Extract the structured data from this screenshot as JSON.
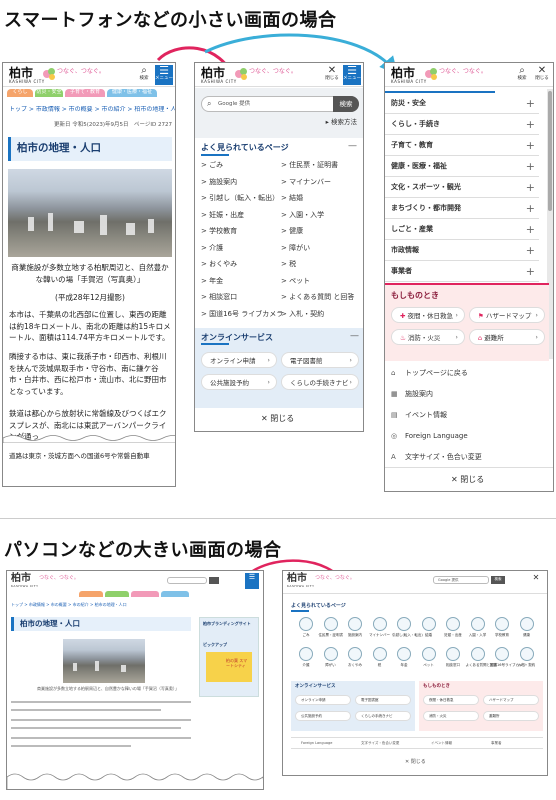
{
  "headings": {
    "smartphone": "スマートフォンなどの小さい画面の場合",
    "pc": "パソコンなどの大きい画面の場合"
  },
  "brand": {
    "logo_text": "柏市",
    "logo_sub": "KASHIWA CITY",
    "slogan": "つなぐ、つなぐ。"
  },
  "header_buttons": {
    "search": "検索",
    "menu": "メニュー",
    "close": "閉じる"
  },
  "page": {
    "breadcrumb": "トップ > 市政情報 > 市の概要 > 市の紹介 > 柏市の地理・人口",
    "updated": "更新日 令和5(2023)年9月5日　ページID 2727",
    "title": "柏市の地理・人口",
    "caption": "商業施設が多数立地する柏駅周辺と、自然豊かな韓いの場「手賀沼（写真奥）」",
    "photo_date": "(平成28年12月撮影)",
    "paragraphs": [
      "本市は、千葉県の北西部に位置し、東西の距離は約18キロメートル、南北の距離は約15キロメートル、面積は114.74平方キロメートルです。",
      "隣接する市は、東に我孫子市・印西市、利根川を挟んで茨城県取手市・守谷市、南に鎌ケ谷市・白井市、西に松戸市・流山市、北に野田市となっています。",
      "鉄道は都心から放射状に常磐線及びつくばエクスプレスが、南北には東武アーバンパークラインが通っ"
    ],
    "fragment": "道路は東京・茨城方面への国道6号や常磐自動車"
  },
  "nav_tabs": [
    "くらし",
    "防災・安全",
    "子育て・教育",
    "健康・医療・福祉"
  ],
  "menu_panel": {
    "search_placeholder": "Google 提供",
    "search_button": "検索",
    "search_help": "検索方法",
    "popular_title": "よく見られているページ",
    "popular_items": [
      "ごみ",
      "住民票・証明書",
      "施設案内",
      "マイナンバー",
      "引越し（転入・転出）",
      "結婚",
      "妊娠・出産",
      "入園・入学",
      "学校教育",
      "健康",
      "介護",
      "障がい",
      "おくやみ",
      "税",
      "年金",
      "ペット",
      "相談窓口",
      "よくある質問 と回答",
      "国道16号 ライブカメラ",
      "入札・契約"
    ],
    "online_title": "オンラインサービス",
    "online_items": [
      "オンライン申請",
      "電子図書館",
      "公共施設予約",
      "くらしの手続きナビ"
    ],
    "close": "閉じる"
  },
  "category_panel": {
    "categories": [
      "防災・安全",
      "くらし・手続き",
      "子育て・教育",
      "健康・医療・福祉",
      "文化・スポーツ・観光",
      "まちづくり・都市開発",
      "しごと・産業",
      "市政情報",
      "事業者"
    ],
    "emergency_title": "もしものとき",
    "emergency_items": [
      "夜間・休日救急",
      "ハザードマップ",
      "消防・火災",
      "避難所"
    ],
    "links": [
      "トップページに戻る",
      "施設案内",
      "イベント情報",
      "Foreign Language",
      "文字サイズ・色合い変更"
    ],
    "close": "閉じる"
  },
  "pc_page": {
    "breadcrumb": "トップ > 市政情報 > 市の概要 > 市の紹介 > 柏市の地理・人口",
    "title": "柏市の地理・人口",
    "caption": "商業施設が多数立地する柏駅周辺と、自然豊かな韓いの場「手賀沼（写真奥）」",
    "side_title": "柏市ブランディングサイト",
    "side_sub": "ピックアップ",
    "side_banner": "柏の葉 スマートシティ"
  },
  "pc_menu": {
    "search_label": "Google 提供",
    "search_button": "検索",
    "close_icon_label": "閉じる",
    "popular_title": "よく見られているページ",
    "tiles": [
      "ごみ",
      "住民票・証明書",
      "施設案内",
      "マイナンバー",
      "引越し(転入・転出)",
      "結婚",
      "妊娠・出産",
      "入園・入学",
      "学校教育",
      "健康",
      "介護",
      "障がい",
      "おくやみ",
      "税",
      "年金",
      "ペット",
      "相談窓口",
      "よくある質問と回答",
      "国道16号ライブカメラ",
      "入札・契約"
    ],
    "online_title": "オンラインサービス",
    "online_items": [
      "オンライン申請",
      "電子図書館",
      "公共施設予約",
      "くらしの手続きナビ"
    ],
    "emergency_title": "もしものとき",
    "emergency_items": [
      "夜間・休日救急",
      "ハザードマップ",
      "消防・火災",
      "避難所"
    ],
    "footer_links": [
      "Foreign Language",
      "文字サイズ・色合い変更",
      "イベント情報",
      "事業者"
    ],
    "close": "閉じる"
  },
  "colors": {
    "brand_blue": "#1a73c2",
    "arrow_red": "#e0245e",
    "arrow_blue": "#3aaed8",
    "emergency_pink": "#fdeaea"
  }
}
